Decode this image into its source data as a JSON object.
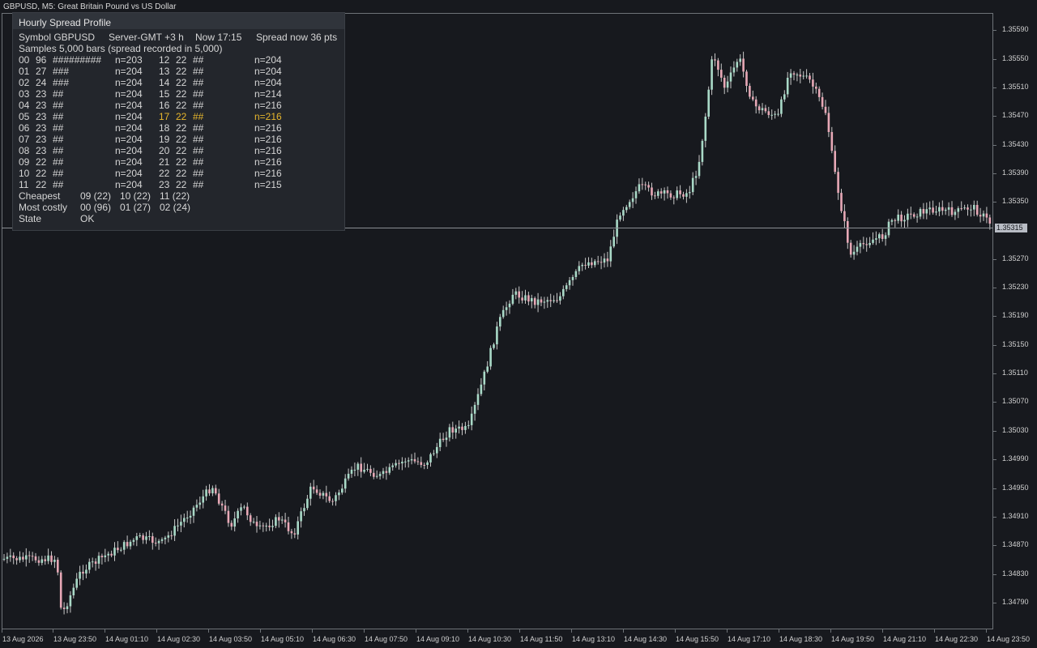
{
  "window": {
    "title": "GBPUSD, M5:  Great Britain Pound vs US Dollar"
  },
  "colors": {
    "background": "#17191e",
    "bull": "#a9d9c7",
    "bear": "#e7a8b6",
    "wick": "#c8c8c8",
    "highlight": "#e7b62d"
  },
  "chart": {
    "symbol": "GBPUSD",
    "timeframe": "M5",
    "current_price": "1.35315",
    "price_labels": [
      "1.35590",
      "1.35550",
      "1.35510",
      "1.35470",
      "1.35430",
      "1.35390",
      "1.35350",
      "1.35270",
      "1.35230",
      "1.35190",
      "1.35150",
      "1.35110",
      "1.35070",
      "1.35030",
      "1.34990",
      "1.34950",
      "1.34910",
      "1.34870",
      "1.34830",
      "1.34790"
    ],
    "time_labels": [
      "13 Aug 2026",
      "13 Aug 23:50",
      "14 Aug 01:10",
      "14 Aug 02:30",
      "14 Aug 03:50",
      "14 Aug 05:10",
      "14 Aug 06:30",
      "14 Aug 07:50",
      "14 Aug 09:10",
      "14 Aug 10:30",
      "14 Aug 11:50",
      "14 Aug 13:10",
      "14 Aug 14:30",
      "14 Aug 15:50",
      "14 Aug 17:10",
      "14 Aug 18:30",
      "14 Aug 19:50",
      "14 Aug 21:10",
      "14 Aug 22:30",
      "14 Aug 23:50"
    ]
  },
  "panel": {
    "title": "Hourly Spread Profile",
    "symbol": "Symbol GBPUSD",
    "server_gmt": "Server-GMT +3 h",
    "now": "Now 17:15",
    "spread_now": "Spread now 36 pts",
    "samples": "Samples 5,000 bars (spread recorded in 5,000)",
    "rows_left": [
      {
        "hour": "00",
        "spread": "96",
        "bar": "#########",
        "n": "n=203"
      },
      {
        "hour": "01",
        "spread": "27",
        "bar": "###",
        "n": "n=204"
      },
      {
        "hour": "02",
        "spread": "24",
        "bar": "###",
        "n": "n=204"
      },
      {
        "hour": "03",
        "spread": "23",
        "bar": "##",
        "n": "n=204"
      },
      {
        "hour": "04",
        "spread": "23",
        "bar": "##",
        "n": "n=204"
      },
      {
        "hour": "05",
        "spread": "23",
        "bar": "##",
        "n": "n=204"
      },
      {
        "hour": "06",
        "spread": "23",
        "bar": "##",
        "n": "n=204"
      },
      {
        "hour": "07",
        "spread": "23",
        "bar": "##",
        "n": "n=204"
      },
      {
        "hour": "08",
        "spread": "23",
        "bar": "##",
        "n": "n=204"
      },
      {
        "hour": "09",
        "spread": "22",
        "bar": "##",
        "n": "n=204"
      },
      {
        "hour": "10",
        "spread": "22",
        "bar": "##",
        "n": "n=204"
      },
      {
        "hour": "11",
        "spread": "22",
        "bar": "##",
        "n": "n=204"
      }
    ],
    "rows_right": [
      {
        "hour": "12",
        "spread": "22",
        "bar": "##",
        "n": "n=204"
      },
      {
        "hour": "13",
        "spread": "22",
        "bar": "##",
        "n": "n=204"
      },
      {
        "hour": "14",
        "spread": "22",
        "bar": "##",
        "n": "n=204"
      },
      {
        "hour": "15",
        "spread": "22",
        "bar": "##",
        "n": "n=214"
      },
      {
        "hour": "16",
        "spread": "22",
        "bar": "##",
        "n": "n=216"
      },
      {
        "hour": "17",
        "spread": "22",
        "bar": "##",
        "n": "n=216",
        "current": true
      },
      {
        "hour": "18",
        "spread": "22",
        "bar": "##",
        "n": "n=216"
      },
      {
        "hour": "19",
        "spread": "22",
        "bar": "##",
        "n": "n=216"
      },
      {
        "hour": "20",
        "spread": "22",
        "bar": "##",
        "n": "n=216"
      },
      {
        "hour": "21",
        "spread": "22",
        "bar": "##",
        "n": "n=216"
      },
      {
        "hour": "22",
        "spread": "22",
        "bar": "##",
        "n": "n=216"
      },
      {
        "hour": "23",
        "spread": "22",
        "bar": "##",
        "n": "n=215"
      }
    ],
    "cheapest_label": "Cheapest",
    "cheapest": [
      "09 (22)",
      "10 (22)",
      "11 (22)"
    ],
    "costly_label": "Most costly",
    "costly": [
      "00 (96)",
      "01 (27)",
      "02 (24)"
    ],
    "state_label": "State",
    "state": "OK"
  }
}
